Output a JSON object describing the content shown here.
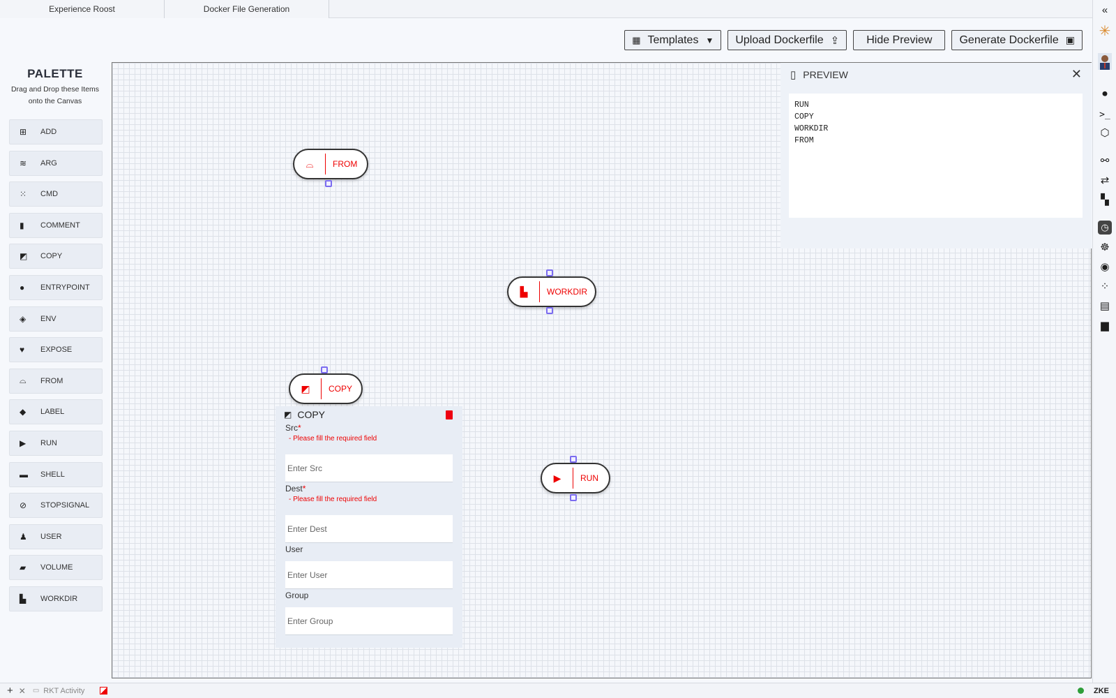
{
  "tabs": [
    {
      "label": "Experience Roost"
    },
    {
      "label": "Docker File Generation"
    }
  ],
  "toolbar": {
    "templates": "Templates",
    "upload": "Upload Dockerfile",
    "hide_preview": "Hide Preview",
    "generate": "Generate Dockerfile"
  },
  "palette": {
    "title": "PALETTE",
    "subtitle_line1": "Drag and Drop these Items",
    "subtitle_line2": "onto the Canvas",
    "items": [
      {
        "label": "ADD",
        "icon": "plus-square-icon"
      },
      {
        "label": "ARG",
        "icon": "layers-icon"
      },
      {
        "label": "CMD",
        "icon": "dots-icon"
      },
      {
        "label": "COMMENT",
        "icon": "comment-icon"
      },
      {
        "label": "COPY",
        "icon": "copy-icon"
      },
      {
        "label": "ENTRYPOINT",
        "icon": "exclamation-icon"
      },
      {
        "label": "ENV",
        "icon": "stack-icon"
      },
      {
        "label": "EXPOSE",
        "icon": "bird-icon"
      },
      {
        "label": "FROM",
        "icon": "inbox-icon"
      },
      {
        "label": "LABEL",
        "icon": "tag-icon"
      },
      {
        "label": "RUN",
        "icon": "play-icon"
      },
      {
        "label": "SHELL",
        "icon": "card-icon"
      },
      {
        "label": "STOPSIGNAL",
        "icon": "ban-icon"
      },
      {
        "label": "USER",
        "icon": "user-icon"
      },
      {
        "label": "VOLUME",
        "icon": "drive-icon"
      },
      {
        "label": "WORKDIR",
        "icon": "folder-icon"
      }
    ]
  },
  "nodes": {
    "from": "FROM",
    "workdir": "WORKDIR",
    "copy": "COPY",
    "run": "RUN"
  },
  "copy_form": {
    "title": "COPY",
    "src_label": "Src",
    "src_error": "- Please fill the required field",
    "src_placeholder": "Enter Src",
    "dest_label": "Dest",
    "dest_error": "- Please fill the required field",
    "dest_placeholder": "Enter Dest",
    "user_label": "User",
    "user_placeholder": "Enter User",
    "group_label": "Group",
    "group_placeholder": "Enter Group",
    "required_mark": "*"
  },
  "preview": {
    "title": "PREVIEW",
    "code": "RUN\nCOPY\nWORKDIR\nFROM"
  },
  "statusbar": {
    "activity": "RKT Activity",
    "right": "ZKE"
  },
  "colors": {
    "accent_red": "#e00000",
    "port_purple": "#7b6cf0",
    "status_green": "#2e9e3a"
  }
}
